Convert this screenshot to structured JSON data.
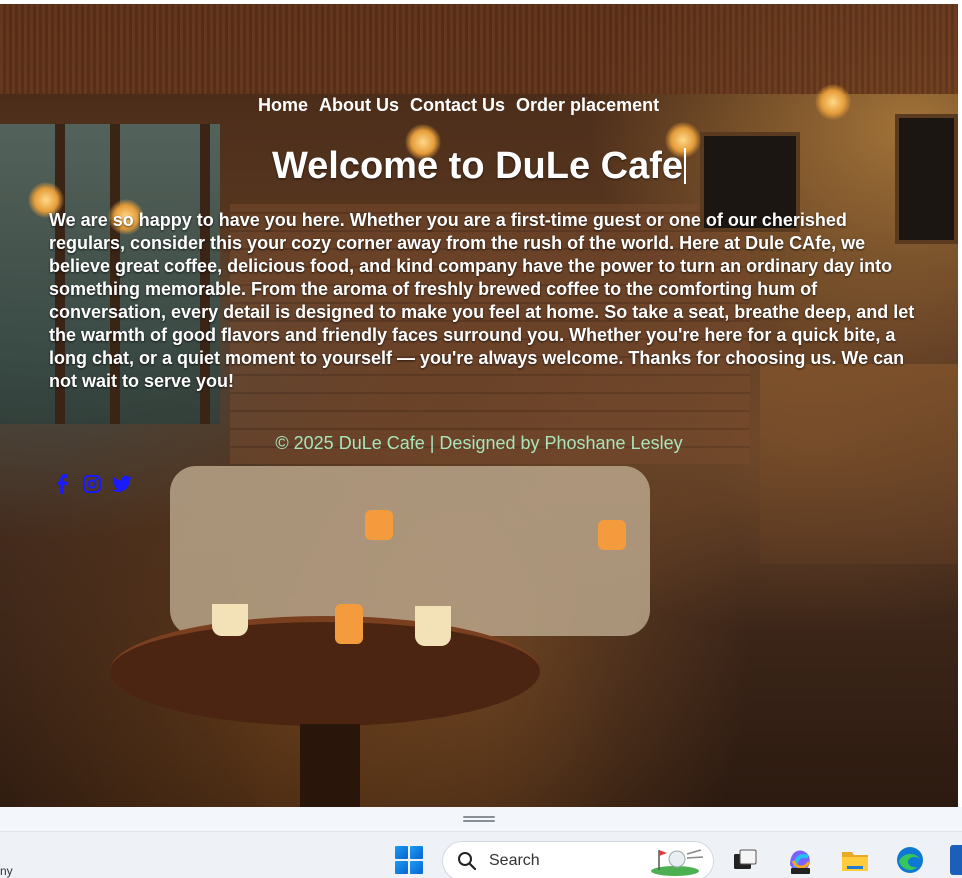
{
  "nav": {
    "items": [
      "Home",
      "About Us",
      "Contact Us",
      "Order placement"
    ]
  },
  "hero": {
    "title": "Welcome to DuLe Cafe",
    "intro": "We are so happy to have you here. Whether you are a first-time guest or one of our cherished regulars, consider this your cozy corner away from the rush of the world. Here at Dule CAfe, we believe great coffee, delicious food, and kind company have the power to turn an ordinary day into something memorable. From the aroma of freshly brewed coffee to the comforting hum of conversation, every detail is designed to make you feel at home. So take a seat, breathe deep, and let the warmth of good flavors and friendly faces surround you. Whether you're here for a quick bite, a long chat, or a quiet moment to yourself — you're always welcome. Thanks for choosing us. We can not wait to serve you!"
  },
  "footer": {
    "copyright": "© 2025 DuLe Cafe | Designed by Phoshane Lesley",
    "social_icons": [
      "facebook-icon",
      "instagram-icon",
      "twitter-icon"
    ]
  },
  "taskbar": {
    "search_label": "Search",
    "tray_text": "ny",
    "icons": [
      "windows-start-icon",
      "search-icon",
      "golf-widget-icon",
      "task-view-icon",
      "m365-copilot-icon",
      "file-explorer-icon",
      "edge-icon"
    ]
  },
  "colors": {
    "nav_text": "#ffffff",
    "footer_text": "#a9e5bb",
    "social_icon": "#1a1aff"
  }
}
